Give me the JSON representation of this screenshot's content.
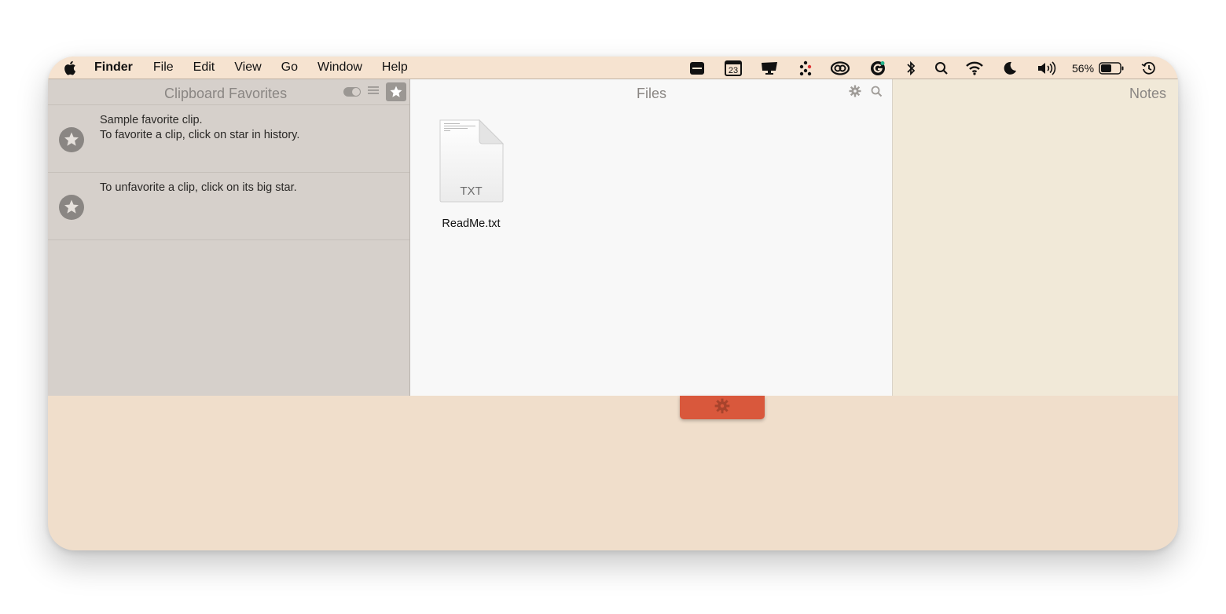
{
  "menubar": {
    "app_name": "Finder",
    "items": [
      "File",
      "Edit",
      "View",
      "Go",
      "Window",
      "Help"
    ],
    "calendar_day": "23",
    "battery_percent": "56%"
  },
  "favorites_panel": {
    "title": "Clipboard Favorites",
    "clips": [
      {
        "text": "Sample favorite clip.\nTo favorite a clip, click on star in history."
      },
      {
        "text": "To unfavorite a clip, click on its big star."
      }
    ]
  },
  "files_panel": {
    "title": "Files",
    "files": [
      {
        "name": "ReadMe.txt",
        "ext": "TXT"
      }
    ]
  },
  "notes_panel": {
    "title": "Notes"
  },
  "colors": {
    "menubar_bg": "#f6e3d0",
    "window_bg": "#f0decb",
    "favorites_bg": "#d6d0cb",
    "files_bg": "#f8f8f8",
    "notes_bg": "#f1e9d8",
    "gear_tab": "#d9583c"
  },
  "icons": {
    "status": [
      "card-icon",
      "calendar-icon",
      "display-icon",
      "dots-icon",
      "creative-cloud-icon",
      "grammarly-icon",
      "bluetooth-icon",
      "search-icon",
      "wifi-icon",
      "moon-icon",
      "volume-icon",
      "battery-icon",
      "time-machine-icon"
    ]
  }
}
